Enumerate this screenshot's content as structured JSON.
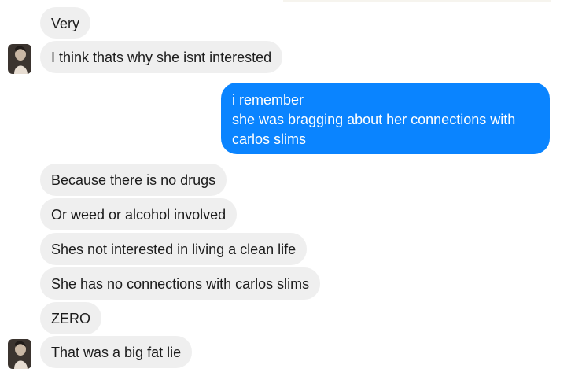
{
  "conversation": {
    "messages": [
      {
        "sender": "them",
        "text": "Very"
      },
      {
        "sender": "them",
        "text": "I think thats why she isnt interested"
      },
      {
        "sender": "me",
        "lines": [
          "i remember",
          "she was bragging about her connections with",
          "carlos slims"
        ]
      },
      {
        "sender": "them",
        "text": "Because there is no drugs"
      },
      {
        "sender": "them",
        "text": "Or weed or alcohol involved"
      },
      {
        "sender": "them",
        "text": "Shes not interested in living a clean life"
      },
      {
        "sender": "them",
        "text": "She has no connections with carlos slims"
      },
      {
        "sender": "them",
        "text": "ZERO"
      },
      {
        "sender": "them",
        "text": "That was a big fat lie"
      }
    ]
  },
  "colors": {
    "incoming_bubble": "#efefef",
    "outgoing_bubble": "#0a84ff",
    "incoming_text": "#1c1c1c",
    "outgoing_text": "#ffffff"
  },
  "icons": {
    "avatar": "contact-avatar-icon"
  }
}
